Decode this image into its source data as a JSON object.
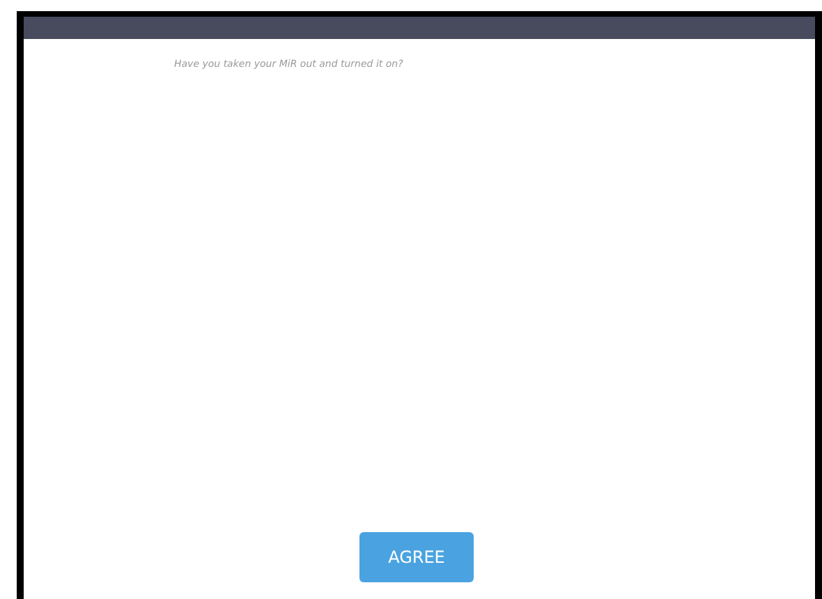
{
  "prompt": "Have you taken your MiR out and turned it on?",
  "button": "AGREE"
}
